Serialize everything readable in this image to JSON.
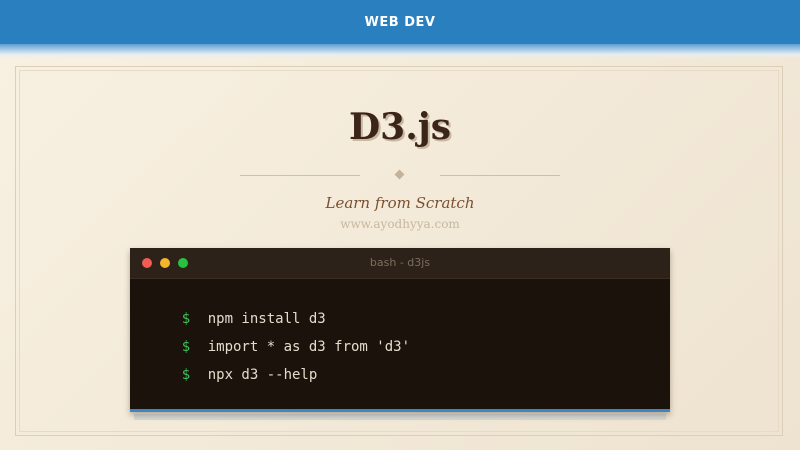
{
  "header": {
    "label": "WEB DEV"
  },
  "title": "D3.js",
  "subtitle": "Learn from Scratch",
  "url": "www.ayodhyya.com",
  "terminal": {
    "title": "bash - d3js",
    "prompt": "$",
    "lines": [
      "npm install d3",
      "import * as d3 from 'd3'",
      "npx d3 --help"
    ]
  },
  "colors": {
    "header_bg": "#2a7fbf",
    "title": "#3b2418",
    "subtitle": "#7a5030",
    "terminal_bg": "#1c120c",
    "prompt": "#3fbf5a"
  }
}
